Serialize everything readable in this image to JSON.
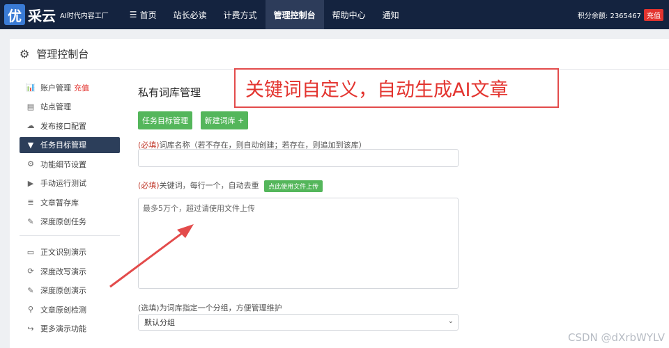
{
  "logo": {
    "badge": "优",
    "name": "采云",
    "tagline": "AI时代内容工厂"
  },
  "nav": {
    "items": [
      {
        "label": "首页",
        "icon": "menu-icon"
      },
      {
        "label": "站长必读"
      },
      {
        "label": "计费方式"
      },
      {
        "label": "管理控制台",
        "active": true
      },
      {
        "label": "帮助中心"
      },
      {
        "label": "通知"
      }
    ],
    "points_label": "积分余额: 2365467",
    "recharge": "充值"
  },
  "header": {
    "title": "管理控制台",
    "icon": "gear-icon"
  },
  "sidebar": {
    "items": [
      {
        "label": "账户管理",
        "accent": "充值",
        "icon": "bar-chart-icon"
      },
      {
        "label": "站点管理",
        "icon": "server-icon"
      },
      {
        "label": "发布接口配置",
        "icon": "cloud-upload-icon"
      },
      {
        "label": "任务目标管理",
        "icon": "filter-icon",
        "active": true
      },
      {
        "label": "功能细节设置",
        "icon": "cogs-icon"
      },
      {
        "label": "手动运行测试",
        "icon": "play-icon"
      },
      {
        "label": "文章暂存库",
        "icon": "database-icon"
      },
      {
        "label": "深度原创任务",
        "icon": "edit-icon"
      }
    ],
    "demo_items": [
      {
        "label": "正文识别演示",
        "icon": "monitor-icon"
      },
      {
        "label": "深度改写演示",
        "icon": "refresh-icon"
      },
      {
        "label": "深度原创演示",
        "icon": "edit-icon"
      },
      {
        "label": "文章原创检测",
        "icon": "search-icon"
      },
      {
        "label": "更多演示功能",
        "icon": "share-icon"
      }
    ]
  },
  "form": {
    "title": "私有词库管理",
    "btn_tasks": "任务目标管理",
    "btn_new": "新建词库 +",
    "required": "(必填)",
    "name_label": "词库名称（若不存在，则自动创建；若存在，则追加到该库）",
    "keywords_label": "关键词，每行一个，自动去重",
    "upload_btn": "点此使用文件上传",
    "keywords_placeholder": "最多5万个，超过请使用文件上传",
    "group_label": "(选填)为词库指定一个分组，方便管理维护",
    "group_selected": "默认分组"
  },
  "annotation": {
    "text": "关键词自定义，自动生成AI文章",
    "color": "#e3342f"
  },
  "watermark": "CSDN @dXrbWYLV",
  "colors": {
    "nav_bg": "#14233f",
    "active_side": "#2c3e5a",
    "green": "#54b65b",
    "red": "#e3342f"
  }
}
